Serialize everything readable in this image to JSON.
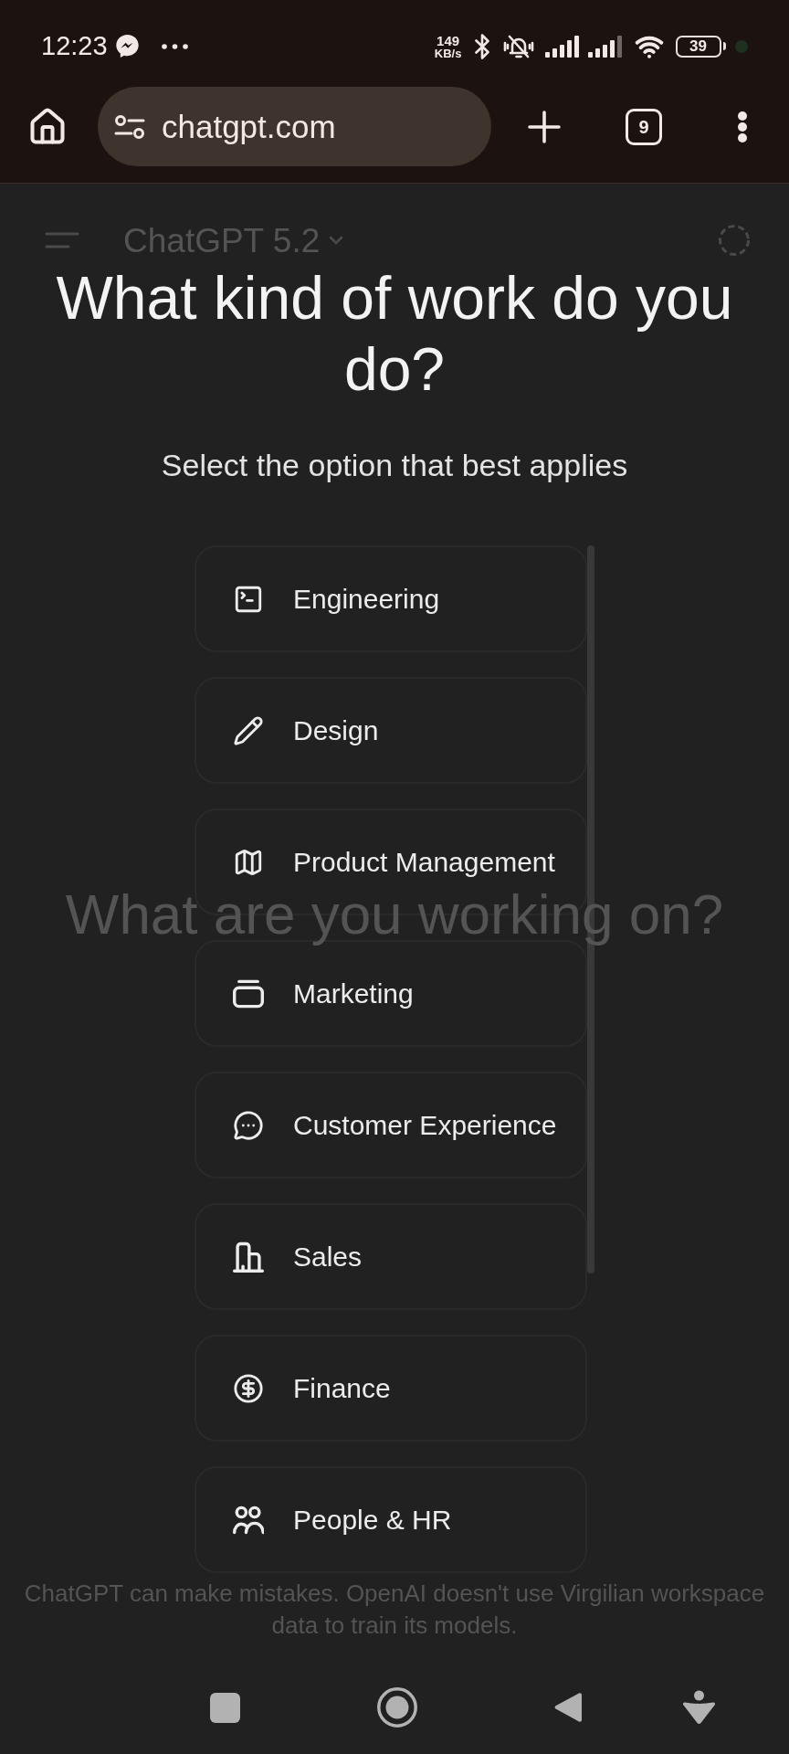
{
  "status_bar": {
    "time": "12:23",
    "speed_value": "149",
    "speed_unit": "KB/s",
    "battery": "39"
  },
  "browser_bar": {
    "url": "chatgpt.com",
    "tab_count": "9"
  },
  "page_behind": {
    "model_name": "ChatGPT 5.2",
    "prompt": "What are you working on?",
    "disclaimer": "ChatGPT can make mistakes. OpenAI doesn't use Virgilian workspace data to train its models."
  },
  "dialog": {
    "title": "What kind of work do you do?",
    "subtitle": "Select the option that best applies",
    "options": [
      {
        "label": "Engineering",
        "selected": false
      },
      {
        "label": "Design",
        "selected": false
      },
      {
        "label": "Product Management",
        "selected": false
      },
      {
        "label": "Marketing",
        "selected": false
      },
      {
        "label": "Customer Experience",
        "selected": false
      },
      {
        "label": "Sales",
        "selected": false
      },
      {
        "label": "Finance",
        "selected": false
      },
      {
        "label": "People & HR",
        "selected": false
      }
    ]
  }
}
